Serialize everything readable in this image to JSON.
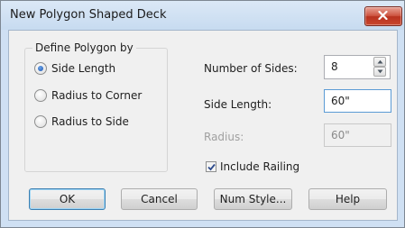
{
  "window": {
    "title": "New Polygon Shaped Deck"
  },
  "define_group": {
    "label": "Define Polygon by",
    "options": [
      {
        "label": "Side Length",
        "checked": true
      },
      {
        "label": "Radius to Corner",
        "checked": false
      },
      {
        "label": "Radius to Side",
        "checked": false
      }
    ]
  },
  "fields": {
    "num_sides": {
      "label": "Number of Sides:",
      "value": "8"
    },
    "side_length": {
      "label": "Side Length:",
      "value": "60\""
    },
    "radius": {
      "label": "Radius:",
      "value": "60\"",
      "enabled": false
    }
  },
  "include_railing": {
    "label": "Include Railing",
    "checked": true
  },
  "buttons": {
    "ok": "OK",
    "cancel": "Cancel",
    "num_style": "Num Style...",
    "help": "Help"
  },
  "colors": {
    "title_bar": "#c7dbf0",
    "close_button": "#c9472f",
    "dialog_bg": "#f0f0f0",
    "focus_border": "#5b9bd5",
    "radio_dot": "#1d55b2"
  }
}
